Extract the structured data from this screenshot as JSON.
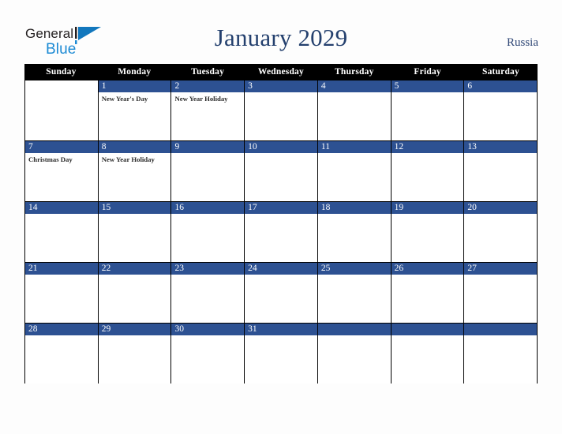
{
  "brand": {
    "name_part1": "General",
    "name_part2": "Blue",
    "logo_icon": "blue-triangle-mark",
    "color_dark": "#231f20",
    "color_blue": "#1b8ad4"
  },
  "header": {
    "title": "January 2029",
    "country": "Russia",
    "title_color": "#24406e"
  },
  "calendar": {
    "month": "January",
    "year": "2029",
    "accent_color": "#2d5192",
    "header_bg": "#000000",
    "weekdays": [
      "Sunday",
      "Monday",
      "Tuesday",
      "Wednesday",
      "Thursday",
      "Friday",
      "Saturday"
    ],
    "weeks": [
      [
        {
          "day": "",
          "events": []
        },
        {
          "day": "1",
          "events": [
            "New Year's Day"
          ]
        },
        {
          "day": "2",
          "events": [
            "New Year Holiday"
          ]
        },
        {
          "day": "3",
          "events": []
        },
        {
          "day": "4",
          "events": []
        },
        {
          "day": "5",
          "events": []
        },
        {
          "day": "6",
          "events": []
        }
      ],
      [
        {
          "day": "7",
          "events": [
            "Christmas Day"
          ]
        },
        {
          "day": "8",
          "events": [
            "New Year Holiday"
          ]
        },
        {
          "day": "9",
          "events": []
        },
        {
          "day": "10",
          "events": []
        },
        {
          "day": "11",
          "events": []
        },
        {
          "day": "12",
          "events": []
        },
        {
          "day": "13",
          "events": []
        }
      ],
      [
        {
          "day": "14",
          "events": []
        },
        {
          "day": "15",
          "events": []
        },
        {
          "day": "16",
          "events": []
        },
        {
          "day": "17",
          "events": []
        },
        {
          "day": "18",
          "events": []
        },
        {
          "day": "19",
          "events": []
        },
        {
          "day": "20",
          "events": []
        }
      ],
      [
        {
          "day": "21",
          "events": []
        },
        {
          "day": "22",
          "events": []
        },
        {
          "day": "23",
          "events": []
        },
        {
          "day": "24",
          "events": []
        },
        {
          "day": "25",
          "events": []
        },
        {
          "day": "26",
          "events": []
        },
        {
          "day": "27",
          "events": []
        }
      ],
      [
        {
          "day": "28",
          "events": []
        },
        {
          "day": "29",
          "events": []
        },
        {
          "day": "30",
          "events": []
        },
        {
          "day": "31",
          "events": []
        },
        {
          "day": "",
          "events": []
        },
        {
          "day": "",
          "events": []
        },
        {
          "day": "",
          "events": []
        }
      ]
    ]
  }
}
